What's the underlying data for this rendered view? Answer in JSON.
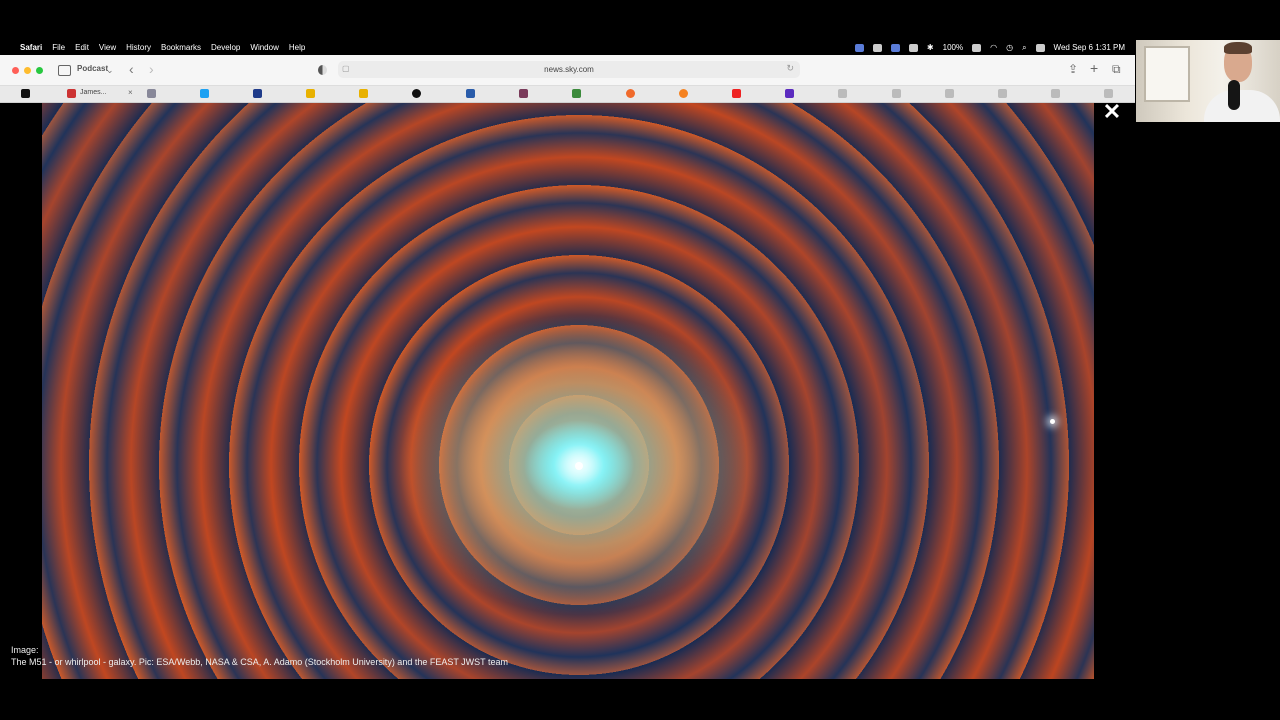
{
  "menubar": {
    "app": "Safari",
    "items": [
      "File",
      "Edit",
      "View",
      "History",
      "Bookmarks",
      "Develop",
      "Window",
      "Help"
    ],
    "battery": "100%",
    "datetime": "Wed Sep 6  1:31 PM"
  },
  "toolbar": {
    "profile": "Podcast",
    "url": "news.sky.com"
  },
  "tabs": {
    "active_label": "James...",
    "close_glyph": "×"
  },
  "content": {
    "close_glyph": "✕",
    "caption_label": "Image:",
    "caption_text": "The M51 - or whirlpool - galaxy. Pic: ESA/Webb, NASA & CSA, A. Adamo (Stockholm University) and the FEAST JWST team"
  },
  "colors": {
    "close_red": "#ff5f57",
    "minimize_yellow": "#febc2e",
    "zoom_green": "#28c840"
  },
  "icons": [
    "apple-icon",
    "sidebar-icon",
    "back-icon",
    "forward-icon",
    "shield-icon",
    "lock-icon",
    "reload-icon",
    "share-icon",
    "new-tab-icon",
    "tab-overview-icon",
    "wifi-icon",
    "bluetooth-icon",
    "search-icon",
    "battery-icon"
  ]
}
